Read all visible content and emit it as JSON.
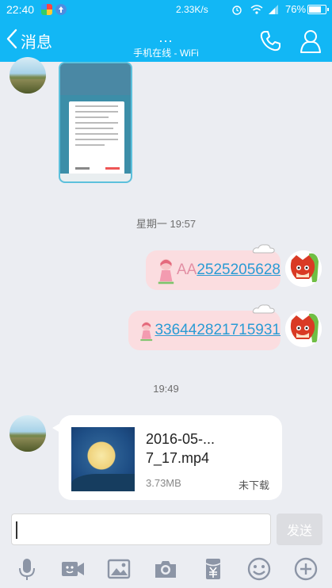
{
  "status_bar": {
    "time": "22:40",
    "network_speed": "2.33K/s",
    "battery_text": "76%",
    "battery_level": 0.76,
    "icons": [
      "app-icon-pinwheel",
      "upload-icon",
      "alarm-icon",
      "wifi-icon",
      "signal-icon",
      "avatar-icon",
      "battery-icon"
    ]
  },
  "header": {
    "back_label": "消息",
    "title_dots": "...",
    "subtitle": "手机在线 - WiFi",
    "accent_color": "#12b7f5"
  },
  "messages": {
    "timestamp_1": "星期一 19:57",
    "msg_1_prefix": "AA",
    "msg_1_link": "2525205628",
    "msg_2_link": "336442821715931",
    "timestamp_2": "19:49",
    "file": {
      "name_line_1": "2016-05-...",
      "name_line_2": "7_17.mp4",
      "size": "3.73MB",
      "status": "未下载"
    }
  },
  "input": {
    "placeholder": "",
    "send_label": "发送"
  },
  "toolbar": {
    "icons": [
      "microphone-icon",
      "video-icon",
      "image-icon",
      "camera-icon",
      "red-packet-icon",
      "emoji-icon",
      "plus-icon"
    ]
  }
}
